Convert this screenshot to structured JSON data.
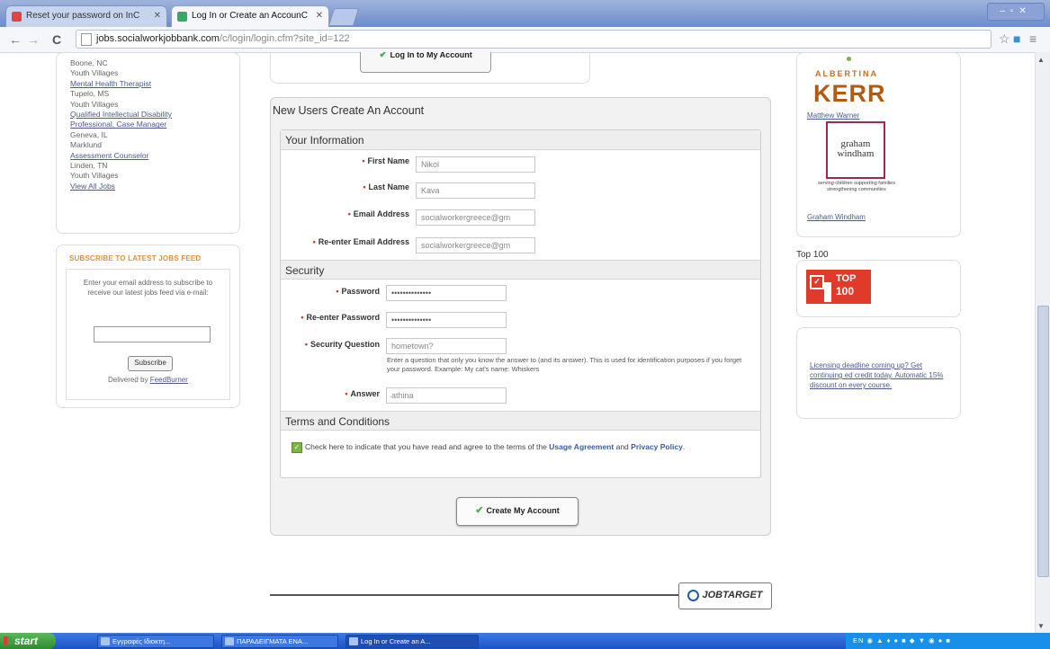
{
  "browser": {
    "tabs": [
      {
        "label": "Reset your password on InС"
      },
      {
        "label": "Log In or Create an AccounС"
      }
    ],
    "url_domain": "jobs.socialworkjobbank.com",
    "url_path": "/c/login/login.cfm?site_id=122"
  },
  "left_jobs": [
    {
      "text": "Boone, NC",
      "link": false
    },
    {
      "text": "Youth Villages",
      "link": false
    },
    {
      "text": "Mental Health Therapist",
      "link": true
    },
    {
      "text": "Tupelo, MS",
      "link": false
    },
    {
      "text": "Youth Villages",
      "link": false
    },
    {
      "text": "Qualified Intellectual Disability",
      "link": true
    },
    {
      "text": "Professional, Case Manager",
      "link": true
    },
    {
      "text": "Geneva, IL",
      "link": false
    },
    {
      "text": "Marklund",
      "link": false
    },
    {
      "text": "Assessment Counselor",
      "link": true
    },
    {
      "text": "Linden, TN",
      "link": false
    },
    {
      "text": "Youth Villages",
      "link": false
    },
    {
      "text": "View All Jobs",
      "link": true
    }
  ],
  "subscribe": {
    "title": "SUBSCRIBE TO LATEST JOBS FEED",
    "description": "Enter your email address to subscribe to receive our latest jobs feed via e-mail:",
    "button": "Subscribe",
    "delivered_prefix": "Delivered by",
    "delivered_link": "FeedBurner"
  },
  "login_button": "Log In to My Account",
  "main": {
    "title": "New Users Create An Account",
    "sections": {
      "info": "Your Information",
      "security": "Security",
      "terms": "Terms and Conditions"
    },
    "fields": {
      "first_name": {
        "label": "First Name",
        "value": "Nikol"
      },
      "last_name": {
        "label": "Last Name",
        "value": "Kava"
      },
      "email": {
        "label": "Email Address",
        "value": "socialworkergreece@gm"
      },
      "email_confirm": {
        "label": "Re-enter Email Address",
        "value": "socialworkergreece@gm"
      },
      "password": {
        "label": "Password",
        "value": "••••••••••••••"
      },
      "password_confirm": {
        "label": "Re-enter Password",
        "value": "••••••••••••••"
      },
      "security_question": {
        "label": "Security Question",
        "value": "hometown?"
      },
      "answer": {
        "label": "Answer",
        "value": "athina"
      }
    },
    "help_text": "Enter a question that only you know the answer to (and its answer). This is used for identification purposes if you forget your password. Example: My cat's name: Whiskers",
    "terms": {
      "text_before": "Check here to indicate that you have read and agree to the terms of the",
      "usage_link": "Usage Agreement",
      "and": "and",
      "privacy_link": "Privacy Policy",
      "period": "."
    },
    "create_button": "Create My Account"
  },
  "footer": {
    "jobtarget": "JOBTARGET"
  },
  "right": {
    "kerr_small": "ALBERTINA",
    "kerr_big": "KERR",
    "kerr_link": "Matthew Warner",
    "graham_logo_1": "graham",
    "graham_logo_2": "windham",
    "graham_tagline": "serving children supporting families strengthening communities",
    "graham_link": "Graham Windham",
    "top100_label": "Top 100",
    "top100_badge_1": "TOP",
    "top100_badge_2": "100",
    "promo": "Licensing deadline coming up? Get continuing ed credit today. Automatic 15% discount on every course."
  },
  "taskbar": {
    "start": "start",
    "tasks": [
      "Εγγραφές Ιδιοκτη...",
      "ΠΑΡΑΔΕΙΓΜΑΤΑ ΕΝΑ...",
      "Log In or Create an A..."
    ],
    "tray_lang": "EN"
  }
}
